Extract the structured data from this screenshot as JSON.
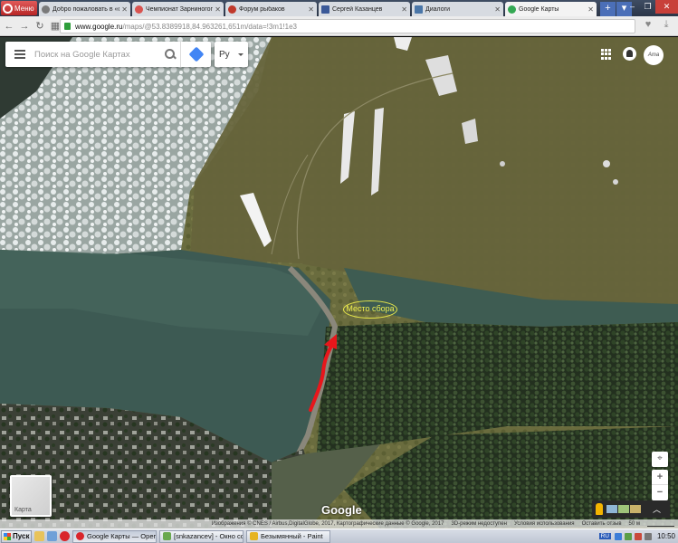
{
  "browser": {
    "menu_label": "Меню",
    "tabs": [
      {
        "title": "Добро пожаловать в «с",
        "favicon_color": "#7a7a7a",
        "active": false
      },
      {
        "title": "Чемпионат Зарниногого",
        "favicon_color": "#d9534f",
        "active": false
      },
      {
        "title": "Форум рыбаков",
        "favicon_color": "#c0392b",
        "active": false
      },
      {
        "title": "Сергей Казанцев",
        "favicon_color": "#3b5998",
        "active": false
      },
      {
        "title": "Диалоги",
        "favicon_color": "#4a76a8",
        "active": false
      },
      {
        "title": "Google Карты",
        "favicon_color": "#34a853",
        "active": true
      }
    ],
    "new_tab_label": "+",
    "tab_menu_label": "▾",
    "url_host": "www.google.ru",
    "url_path": "/maps/@53.8389918,84.963261,651m/data=!3m1!1e3"
  },
  "maps": {
    "search_placeholder": "Поиск на Google Картах",
    "language_label": "Ру",
    "annotation_label": "Место сбора",
    "google_logo": "Google",
    "layer_label": "Карта",
    "zoom_in": "+",
    "zoom_out": "−",
    "compass": "⌖",
    "footer": {
      "imagery": "Изображения © CNES / Airbus,DigitalGlobe, 2017, Картографические данные © Google, 2017",
      "mode": "3D-режим недоступен",
      "terms": "Условия использования",
      "feedback": "Оставить отзыв",
      "scale": "50 м"
    },
    "colors": {
      "annotation": "#f0f050",
      "route_arrow": "#e8161b"
    }
  },
  "taskbar": {
    "start_label": "Пуск",
    "windows": [
      {
        "title": "Google Карты — Opera",
        "icon_color": "#d9252b",
        "active": true
      },
      {
        "title": "[snkazancev] - Окно соо...",
        "icon_color": "#6aa84f",
        "active": false
      },
      {
        "title": "Безымянный - Paint",
        "icon_color": "#e6b422",
        "active": false
      }
    ],
    "language": "RU",
    "clock": "10:50"
  }
}
